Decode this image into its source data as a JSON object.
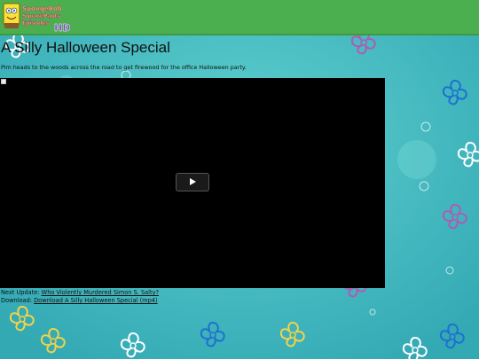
{
  "site": {
    "logo_text_line1": "SpongeBob",
    "logo_text_line2": "SquarePants",
    "logo_text_line3": "Episodes",
    "logo_badge": "HD"
  },
  "colors": {
    "header_bg": "#4caf4f",
    "page_bg": "#3fb9bd",
    "player_bg": "#000000"
  },
  "page": {
    "title": "A Silly Halloween Special",
    "description": "Pim heads to the woods across the road to get firewood for the office Halloween party."
  },
  "player": {
    "play_icon": "play-icon"
  },
  "next_update": {
    "label": "Next Update:",
    "link_text": "Who Violently Murdered Simon S. Salty?"
  },
  "download": {
    "label": "Download:",
    "link_text": "Download A Silly Halloween Special (mp4)"
  }
}
